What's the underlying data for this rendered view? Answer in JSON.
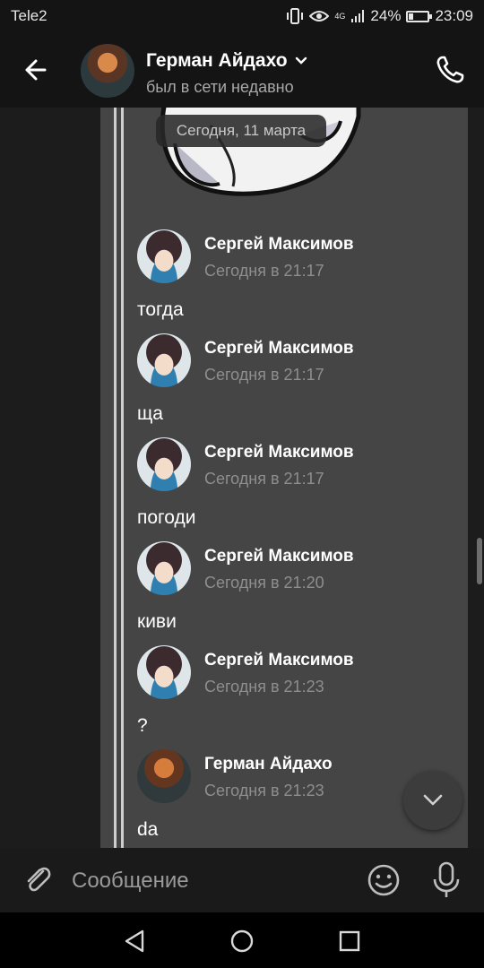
{
  "status_bar": {
    "carrier": "Tele2",
    "network": "4G",
    "battery": "24%",
    "battery_level": 0.24,
    "time": "23:09"
  },
  "header": {
    "title": "Герман Айдахо",
    "subtitle": "был в сети недавно"
  },
  "chat": {
    "date_pill": "Сегодня, 11 марта",
    "messages": [
      {
        "author": "Сергей Максимов",
        "time": "Сегодня в 21:17",
        "text": "тогда"
      },
      {
        "author": "Сергей Максимов",
        "time": "Сегодня в 21:17",
        "text": "ща"
      },
      {
        "author": "Сергей Максимов",
        "time": "Сегодня в 21:17",
        "text": "погоди"
      },
      {
        "author": "Сергей Максимов",
        "time": "Сегодня в 21:20",
        "text": "киви"
      },
      {
        "author": "Сергей Максимов",
        "time": "Сегодня в 21:23",
        "text": "?"
      },
      {
        "author": "Герман Айдахо",
        "time": "Сегодня в 21:23",
        "text": "da"
      }
    ]
  },
  "composer": {
    "placeholder": "Сообщение"
  },
  "icons": {
    "back": "arrow-left-icon",
    "call": "phone-icon",
    "attach": "paperclip-icon",
    "emoji": "smiley-icon",
    "mic": "microphone-icon",
    "scroll_down": "chevron-down-icon"
  },
  "colors": {
    "background": "#141414",
    "panel": "#454545",
    "muted_text": "#8e8e8e"
  }
}
